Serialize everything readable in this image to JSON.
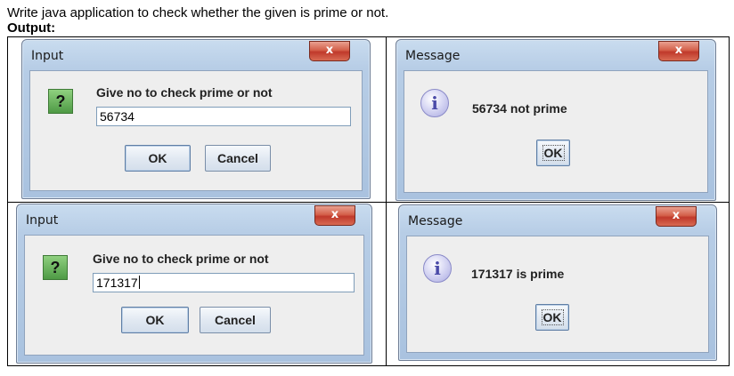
{
  "page": {
    "heading": "Write java application to check whether the given is prime or not.",
    "output_label": "Output:"
  },
  "dialogs": {
    "input1": {
      "title": "Input",
      "close": "x",
      "prompt": "Give no to check prime or not",
      "value": "56734",
      "ok": "OK",
      "cancel": "Cancel",
      "icon": "question-icon"
    },
    "message1": {
      "title": "Message",
      "close": "x",
      "text": "56734 not prime",
      "ok": "OK",
      "icon": "information-icon"
    },
    "input2": {
      "title": "Input",
      "close": "x",
      "prompt": "Give no to check prime or not",
      "value": "171317",
      "ok": "OK",
      "cancel": "Cancel",
      "icon": "question-icon"
    },
    "message2": {
      "title": "Message",
      "close": "x",
      "text": "171317 is prime",
      "ok": "OK",
      "icon": "information-icon"
    }
  },
  "colors": {
    "close_button": "#c0392b",
    "question_icon": "#4e9a45",
    "info_icon": "#a9a9e0",
    "window_frame": "#a9c2df"
  }
}
